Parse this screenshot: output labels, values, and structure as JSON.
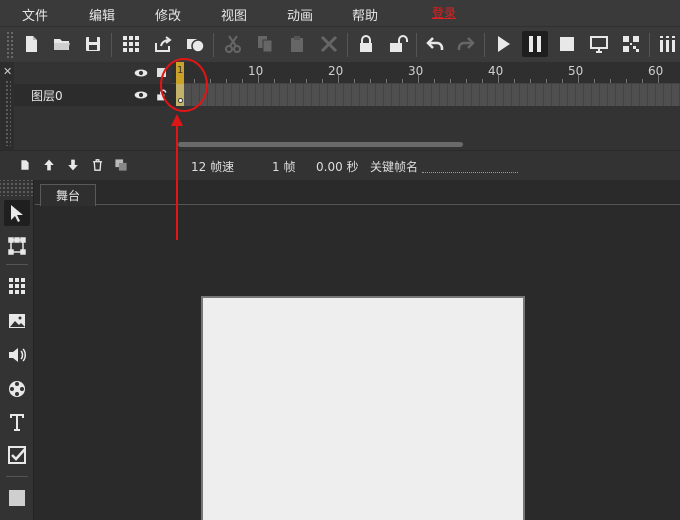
{
  "menu": {
    "items": [
      "文件",
      "编辑",
      "修改",
      "视图",
      "动画",
      "帮助"
    ],
    "special": "登录"
  },
  "toolbar": {
    "icons": [
      "new-file-icon",
      "open-folder-icon",
      "save-icon",
      "grid-icon",
      "share-icon",
      "shape-icon",
      "cut-icon",
      "copy-icon",
      "paste-icon",
      "delete-icon",
      "lock-icon",
      "unlock-icon",
      "undo-icon",
      "redo-icon",
      "play-icon",
      "pause-icon",
      "stop-icon",
      "preview-screen-icon",
      "qr-code-icon",
      "more-icon"
    ]
  },
  "timeline": {
    "ruler_labels": [
      "1",
      "10",
      "20",
      "30",
      "40",
      "50",
      "60"
    ],
    "layer_name": "图层0",
    "fps": "12 帧速",
    "frame": "1 帧",
    "time": "0.00 秒",
    "keyframe_label": "关键帧名",
    "keyframe_value": ""
  },
  "tools": [
    "select-arrow-icon",
    "transform-icon",
    "grid-icon",
    "image-icon",
    "sound-icon",
    "film-reel-icon",
    "text-icon",
    "checkbox-icon",
    "rectangle-icon"
  ],
  "stage": {
    "tab_label": "舞台"
  },
  "colors": {
    "accent": "#c9a227",
    "annotation": "#e01515",
    "canvas": "#eeeeee"
  }
}
